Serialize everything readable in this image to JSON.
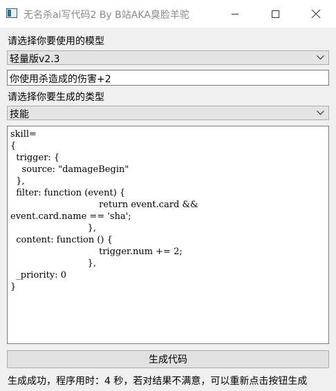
{
  "window": {
    "title": "无名杀ai写代码2 By B站AKA臭脸羊驼",
    "icon": "app-window-icon",
    "controls": [
      "minimize-icon",
      "maximize-icon",
      "close-icon"
    ]
  },
  "model_label": "请选择你要使用的模型",
  "model_select": {
    "value": "轻量版v2.3",
    "icon": "chevron-down-icon"
  },
  "prompt_input": {
    "value": "你使用杀造成的伤害+2"
  },
  "type_label": "请选择你要生成的类型",
  "type_select": {
    "value": "技能",
    "icon": "chevron-down-icon"
  },
  "code_output": "skill=\n{\n  trigger: {\n    source: \"damageBegin\"\n  },\n  filter: function (event) {\n                               return event.card &&\nevent.card.name == 'sha';\n                           },\n  content: function () {\n                               trigger.num += 2;\n                           },\n  _priority: 0\n}",
  "generate_button": "生成代码",
  "status_text": "生成成功，程序用时：4 秒，若对结果不满意，可以重新点击按钮生成"
}
